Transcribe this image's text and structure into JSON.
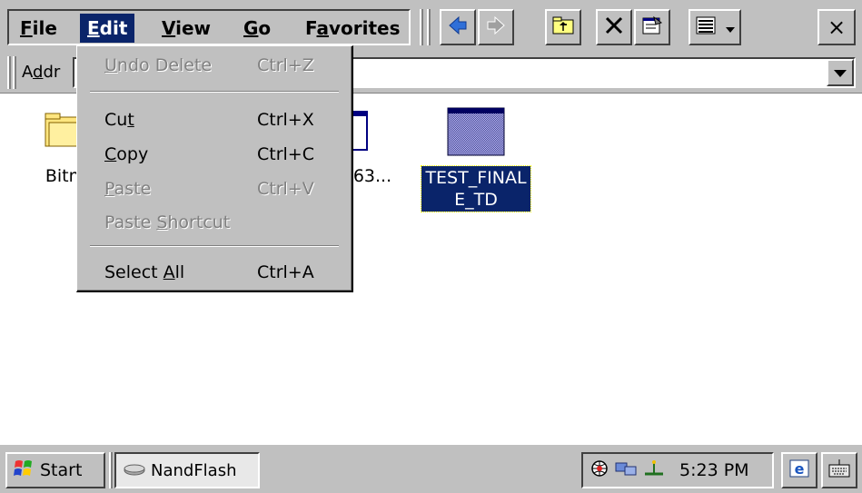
{
  "menubar": {
    "items": [
      {
        "label": "File",
        "mnemonic": "F",
        "rest": "ile"
      },
      {
        "label": "Edit",
        "mnemonic": "E",
        "rest": "dit"
      },
      {
        "label": "View",
        "mnemonic": "V",
        "rest": "iew"
      },
      {
        "label": "Go",
        "mnemonic": "G",
        "rest": "o"
      },
      {
        "label": "Favorites",
        "pre": "F",
        "mnemonic": "a",
        "rest": "vorites"
      }
    ],
    "active": "Edit"
  },
  "toolbar": {
    "icons": [
      "back-arrow-icon",
      "forward-arrow-icon",
      "up-folder-icon",
      "delete-icon",
      "properties-icon",
      "views-icon"
    ],
    "close_label": "×"
  },
  "address": {
    "label_pre": "A",
    "label_mnemonic": "d",
    "label_rest": "dr",
    "value": ""
  },
  "edit_menu": {
    "items": [
      {
        "pre": "",
        "mn": "U",
        "post": "ndo Delete",
        "shortcut": "Ctrl+Z",
        "enabled": false
      },
      {
        "pre": "Cu",
        "mn": "t",
        "post": "",
        "shortcut": "Ctrl+X",
        "enabled": true
      },
      {
        "pre": "",
        "mn": "C",
        "post": "opy",
        "shortcut": "Ctrl+C",
        "enabled": true
      },
      {
        "pre": "",
        "mn": "P",
        "post": "aste",
        "shortcut": "Ctrl+V",
        "enabled": false
      },
      {
        "pre": "Paste ",
        "mn": "S",
        "post": "hortcut",
        "shortcut": "",
        "enabled": false
      },
      {
        "pre": "Select ",
        "mn": "A",
        "post": "ll",
        "shortcut": "Ctrl+A",
        "enabled": true
      }
    ]
  },
  "files": [
    {
      "name": "Bitm",
      "type": "folder"
    },
    {
      "name": "63...",
      "type": "file"
    },
    {
      "name_line1": "TEST_FINAL",
      "name_line2": "E_TD",
      "type": "app",
      "selected": true
    }
  ],
  "taskbar": {
    "start_label": "Start",
    "task_label": "NandFlash",
    "clock": "5:23 PM"
  },
  "colors": {
    "chrome": "#c0c0c0",
    "highlight": "#0a246a",
    "disabled_text": "#808080"
  }
}
